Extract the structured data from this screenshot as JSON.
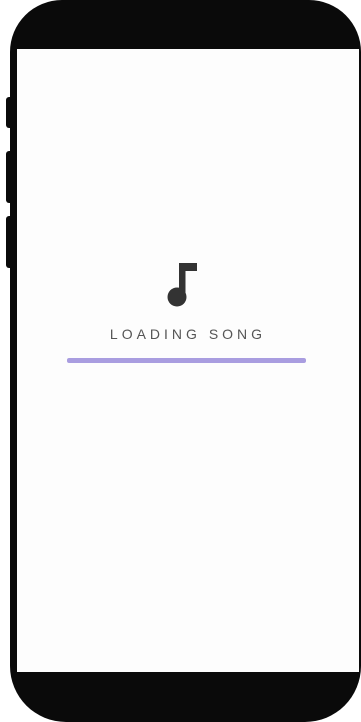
{
  "loading": {
    "label": "LOADING SONG",
    "progress": 1.0,
    "icon": "music-note-icon"
  },
  "colors": {
    "accent": "#a99de0",
    "icon": "#333333",
    "text": "#555555",
    "device": "#0a0a0a"
  }
}
